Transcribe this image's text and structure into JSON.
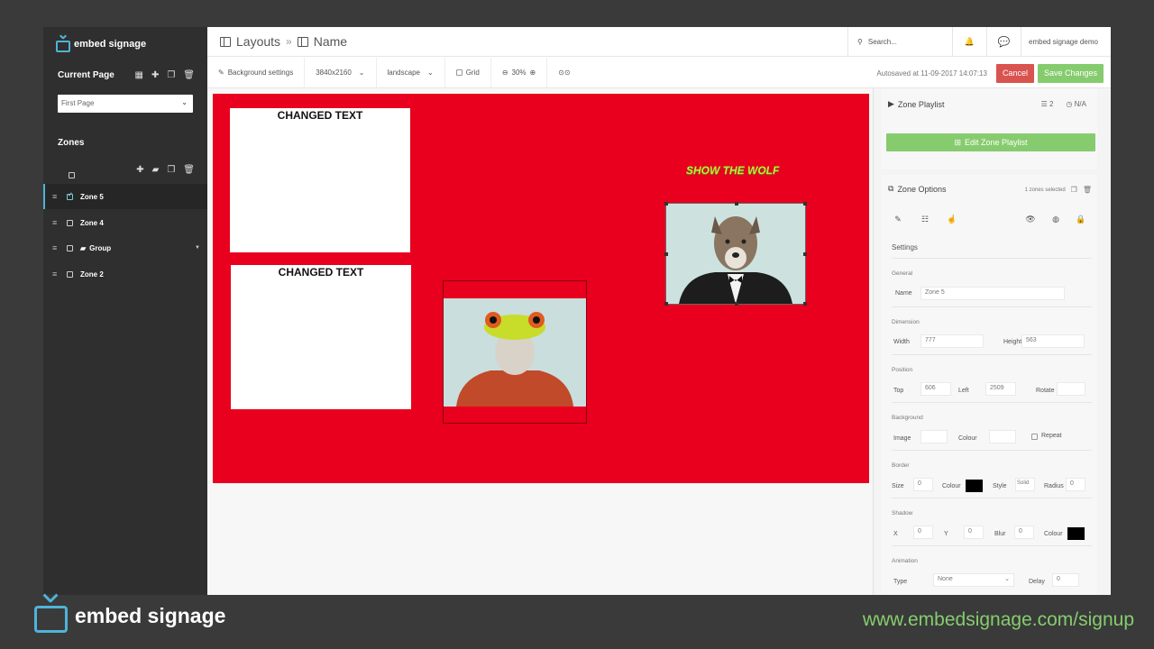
{
  "sidebar": {
    "brand": "embed signage",
    "current_page_heading": "Current Page",
    "page_select_value": "First Page",
    "zones_heading": "Zones",
    "zones": [
      {
        "label": "Zone 5",
        "active": true
      },
      {
        "label": "Zone 4",
        "active": false
      },
      {
        "label": "Group",
        "active": false,
        "folder": true
      },
      {
        "label": "Zone 2",
        "active": false
      }
    ]
  },
  "header": {
    "breadcrumb_root": "Layouts",
    "breadcrumb_separator": "»",
    "breadcrumb_current": "Name",
    "search_placeholder": "Search...",
    "user_name": "embed signage demo"
  },
  "toolbar": {
    "background_settings": "Background settings",
    "resolution": "3840x2160",
    "orientation": "landscape",
    "grid_label": "Grid",
    "zoom_level": "30%",
    "autosave_text": "Autosaved at 11-09-2017 14:07:13",
    "cancel_label": "Cancel",
    "save_label": "Save Changes"
  },
  "canvas": {
    "background_color": "#e8001e",
    "zone_text_1": "CHANGED TEXT",
    "zone_text_2": "CHANGED TEXT",
    "wolf_title": "SHOW THE WOLF"
  },
  "zone_playlist": {
    "title": "Zone Playlist",
    "count": "2",
    "duration": "N/A",
    "edit_button": "Edit Zone Playlist"
  },
  "zone_options": {
    "title": "Zone Options",
    "selected_text": "1 zones selected",
    "settings_tab": "Settings",
    "general_label": "General",
    "name_label": "Name",
    "name_value": "Zone 5",
    "dimension_label": "Dimension",
    "width_label": "Width",
    "width_value": "777",
    "height_label": "Height",
    "height_value": "563",
    "position_label": "Position",
    "top_label": "Top",
    "top_value": "606",
    "left_label": "Left",
    "left_value": "2509",
    "rotate_label": "Rotate",
    "background_label": "Background",
    "image_label": "Image",
    "colour_label": "Colour",
    "repeat_label": "Repeat",
    "border_label": "Border",
    "size_label": "Size",
    "border_size": "0",
    "border_colour_label": "Colour",
    "style_label": "Style",
    "style_value": "Solid",
    "radius_label": "Radius",
    "radius_value": "0",
    "shadow_label": "Shadow",
    "x_label": "X",
    "x_value": "0",
    "y_label": "Y",
    "y_value": "0",
    "blur_label": "Blur",
    "blur_value": "0",
    "shadow_colour_label": "Colour",
    "animation_label": "Animation",
    "type_label": "Type",
    "type_value": "None",
    "delay_label": "Delay",
    "delay_value": "0"
  },
  "footer": {
    "brand": "embed signage",
    "url": "www.embedsignage.com/signup"
  },
  "colors": {
    "accent_blue": "#4fb3d9",
    "accent_green": "#86cc6e",
    "cancel_red": "#d9534f"
  }
}
